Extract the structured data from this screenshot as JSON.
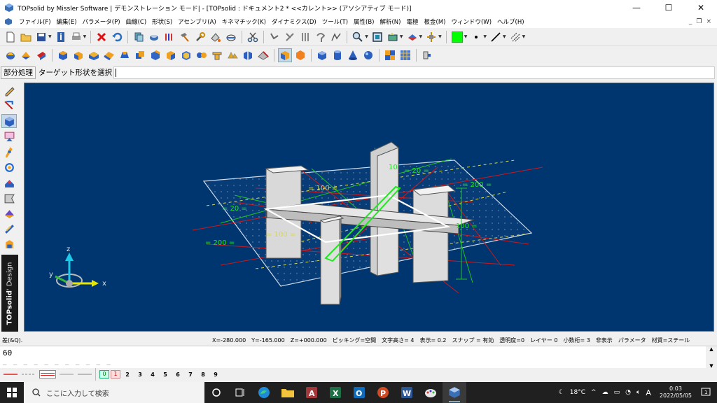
{
  "window": {
    "title": "TOPsolid by Missler Software | デモンストレーション モード| - [TOPsolid : ドキュメント2 *  <<カレント>> (アソシアティブ モード)]",
    "minimize": "—",
    "maximize": "☐",
    "close": "✕"
  },
  "menu": {
    "items": [
      "ファイル(F)",
      "編集(E)",
      "パラメータ(P)",
      "曲線(C)",
      "形状(S)",
      "アセンブリ(A)",
      "キネマチック(K)",
      "ダイナミクス(D)",
      "ツール(T)",
      "属性(B)",
      "解析(N)",
      "電極",
      "板金(M)",
      "ウィンドウ(W)",
      "ヘルプ(H)"
    ],
    "mdi_minimize": "_",
    "mdi_restore": "❐",
    "mdi_close": "×"
  },
  "prompt": {
    "label": "部分処理",
    "text": "ターゲット形状を選択"
  },
  "brand": {
    "name": "TOPsolid",
    "suffix": "' Design"
  },
  "viewport": {
    "background": "#003670",
    "axes": {
      "x": "x",
      "y": "y",
      "z": "z"
    },
    "dimensions": [
      "= 20 =",
      "= 100 =",
      "= 200 =",
      "= 20 =",
      "= 100 =",
      "= 200 =",
      "100 =",
      "= 200 =",
      "10"
    ]
  },
  "status": {
    "left": "差(&Q).",
    "x": "X=-280.000",
    "y": "Y=-165.000",
    "z": "Z=+000.000",
    "picking": "ピッキング=空間",
    "text_height": "文字高さ=  4",
    "display": "表示=   0.2",
    "snap": "スナップ = 有効",
    "transparency": "透明度=0",
    "layer": "レイヤー  0",
    "decimals": "小数桁= 3",
    "hidden": "非表示",
    "params": "パラメータ",
    "material": "材質=スチール"
  },
  "command": {
    "value": "60",
    "dashes": "_ _ _ _ _ _ _ _ _ _ _"
  },
  "layers": {
    "active": [
      "0",
      "1"
    ],
    "numbers": [
      "2",
      "3",
      "4",
      "5",
      "6",
      "7",
      "8",
      "9"
    ]
  },
  "taskbar": {
    "search_placeholder": "ここに入力して検索",
    "weather": "18°C",
    "ime": "A",
    "time": "0:03",
    "date": "2022/05/05",
    "notifications": "1"
  },
  "colors": {
    "accent_green": "#00ff00",
    "viewport_bg": "#003670",
    "taskbar": "#202020"
  }
}
